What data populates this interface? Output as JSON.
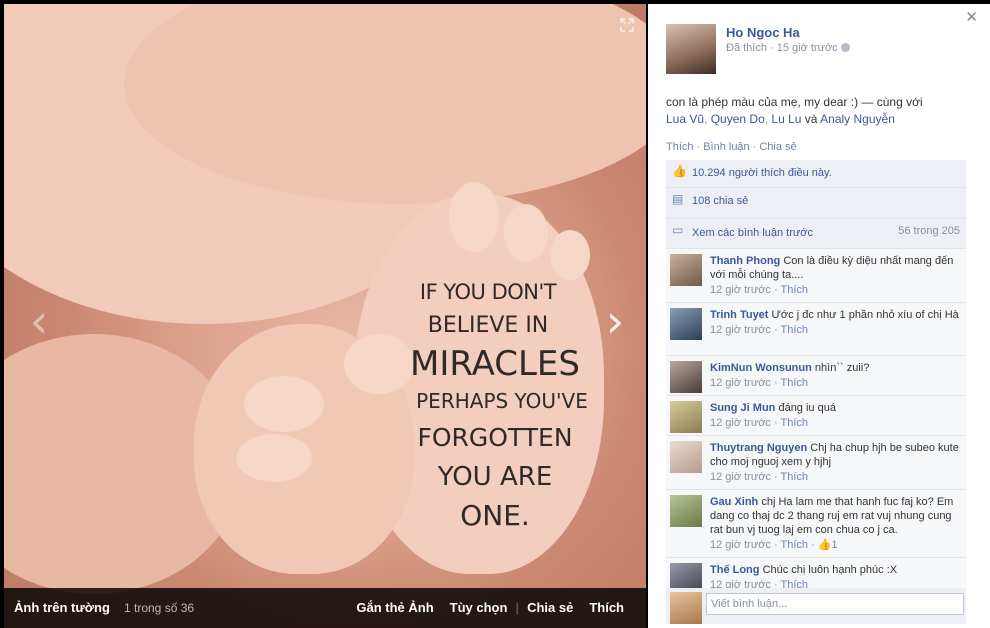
{
  "viewer": {
    "album_label": "Ảnh trên tường",
    "position_text": "1 trong số 36",
    "footer_actions": [
      "Gắn thẻ Ảnh",
      "Tùy chọn",
      "Chia sẻ",
      "Thích"
    ],
    "expand_icon": "expand-icon",
    "prev_icon": "chevron-left",
    "next_icon": "chevron-right"
  },
  "photo": {
    "quote_lines": [
      "IF YOU DON'T",
      "BELIEVE IN",
      "MIRACLES",
      "PERHAPS YOU'VE",
      "FORGOTTEN",
      "YOU ARE",
      "ONE."
    ]
  },
  "post": {
    "author": "Ho Ngoc Ha",
    "meta": "Đã thích · 15 giờ trước",
    "caption_text": "con là phép màu của mẹ, my dear :) — cùng với",
    "tagged": [
      "Lua Vũ",
      "Quyen Do",
      "Lu Lu",
      "Analy Nguyễn"
    ],
    "caption_joiner_and": "và",
    "actions": [
      "Thích",
      "Bình luận",
      "Chia sẻ"
    ],
    "likes_text": "10.294 người thích điều này.",
    "shares_text": "108 chia sẻ",
    "view_prev": "Xem các bình luận trước",
    "view_prev_count": "56 trong 205"
  },
  "comments": [
    {
      "name": "Thanh Phong",
      "text": "Con là điều kỳ diệu nhất mang đến với mỗi chúng ta....",
      "time": "12 giờ trước",
      "like": "Thích",
      "color": "#6e5a4a"
    },
    {
      "name": "Trinh Tuyet",
      "text": "Ước j đc như 1 phần nhỏ xíu of chị Hà",
      "time": "12 giờ trước",
      "like": "Thích",
      "color": "#2c3e55"
    },
    {
      "name": "KimNun Wonsunun",
      "text": "nhìn`` zuii?",
      "time": "12 giờ trước",
      "like": "Thích",
      "color": "#4a3b3b"
    },
    {
      "name": "Sung Ji Mun",
      "text": "đáng iu quá",
      "time": "12 giờ trước",
      "like": "Thích",
      "color": "#8a7a55"
    },
    {
      "name": "Thuytrang Nguyen",
      "text": "Chj ha chup hjh be subeo kute cho moj nguoj xem y hjhj",
      "time": "12 giờ trước",
      "like": "Thích",
      "color": "#b89a8a"
    },
    {
      "name": "Gau Xinh",
      "text": "chj Ha lam me that hanh fuc faj ko? Em dang co thaj dc 2 thang ruj em rat vuj nhung cung rat bun vj tuog laj em con chua co j ca.",
      "time": "12 giờ trước",
      "like": "Thích",
      "like_count": "1",
      "color": "#6b7a45"
    },
    {
      "name": "Thế Long",
      "text": "Chúc chị luôn hạnh phúc :X",
      "time": "12 giờ trước",
      "like": "Thích",
      "color": "#3a3a4a"
    }
  ],
  "composer": {
    "placeholder": "Viết bình luận..."
  }
}
